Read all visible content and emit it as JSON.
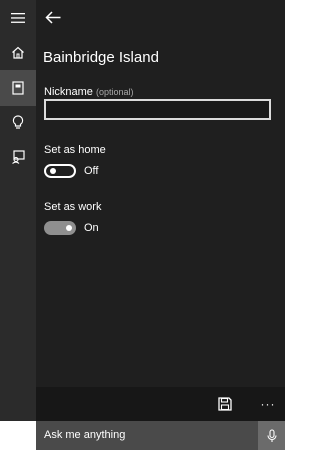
{
  "rail": {
    "items": [
      {
        "icon": "hamburger-menu-icon"
      },
      {
        "icon": "home-icon"
      },
      {
        "icon": "notebook-icon",
        "selected": true
      },
      {
        "icon": "lightbulb-icon"
      },
      {
        "icon": "feedback-icon"
      }
    ]
  },
  "header": {
    "back_icon": "back-arrow-icon"
  },
  "main": {
    "title": "Bainbridge Island",
    "nickname": {
      "label": "Nickname",
      "optional": "(optional)",
      "value": "",
      "placeholder": ""
    },
    "home": {
      "label": "Set as home",
      "state": "Off",
      "on": false
    },
    "work": {
      "label": "Set as work",
      "state": "On",
      "on": true
    }
  },
  "bottombar": {
    "save_icon": "save-icon",
    "more": "···"
  },
  "search": {
    "prompt": "Ask me anything",
    "mic_icon": "microphone-icon"
  },
  "colors": {
    "rail": "#2b2b2b",
    "content": "#1f1f1f",
    "selected": "#4a4a4a",
    "searchbar": "#4a4a4a",
    "toggle_on": "#8f8f8f"
  }
}
